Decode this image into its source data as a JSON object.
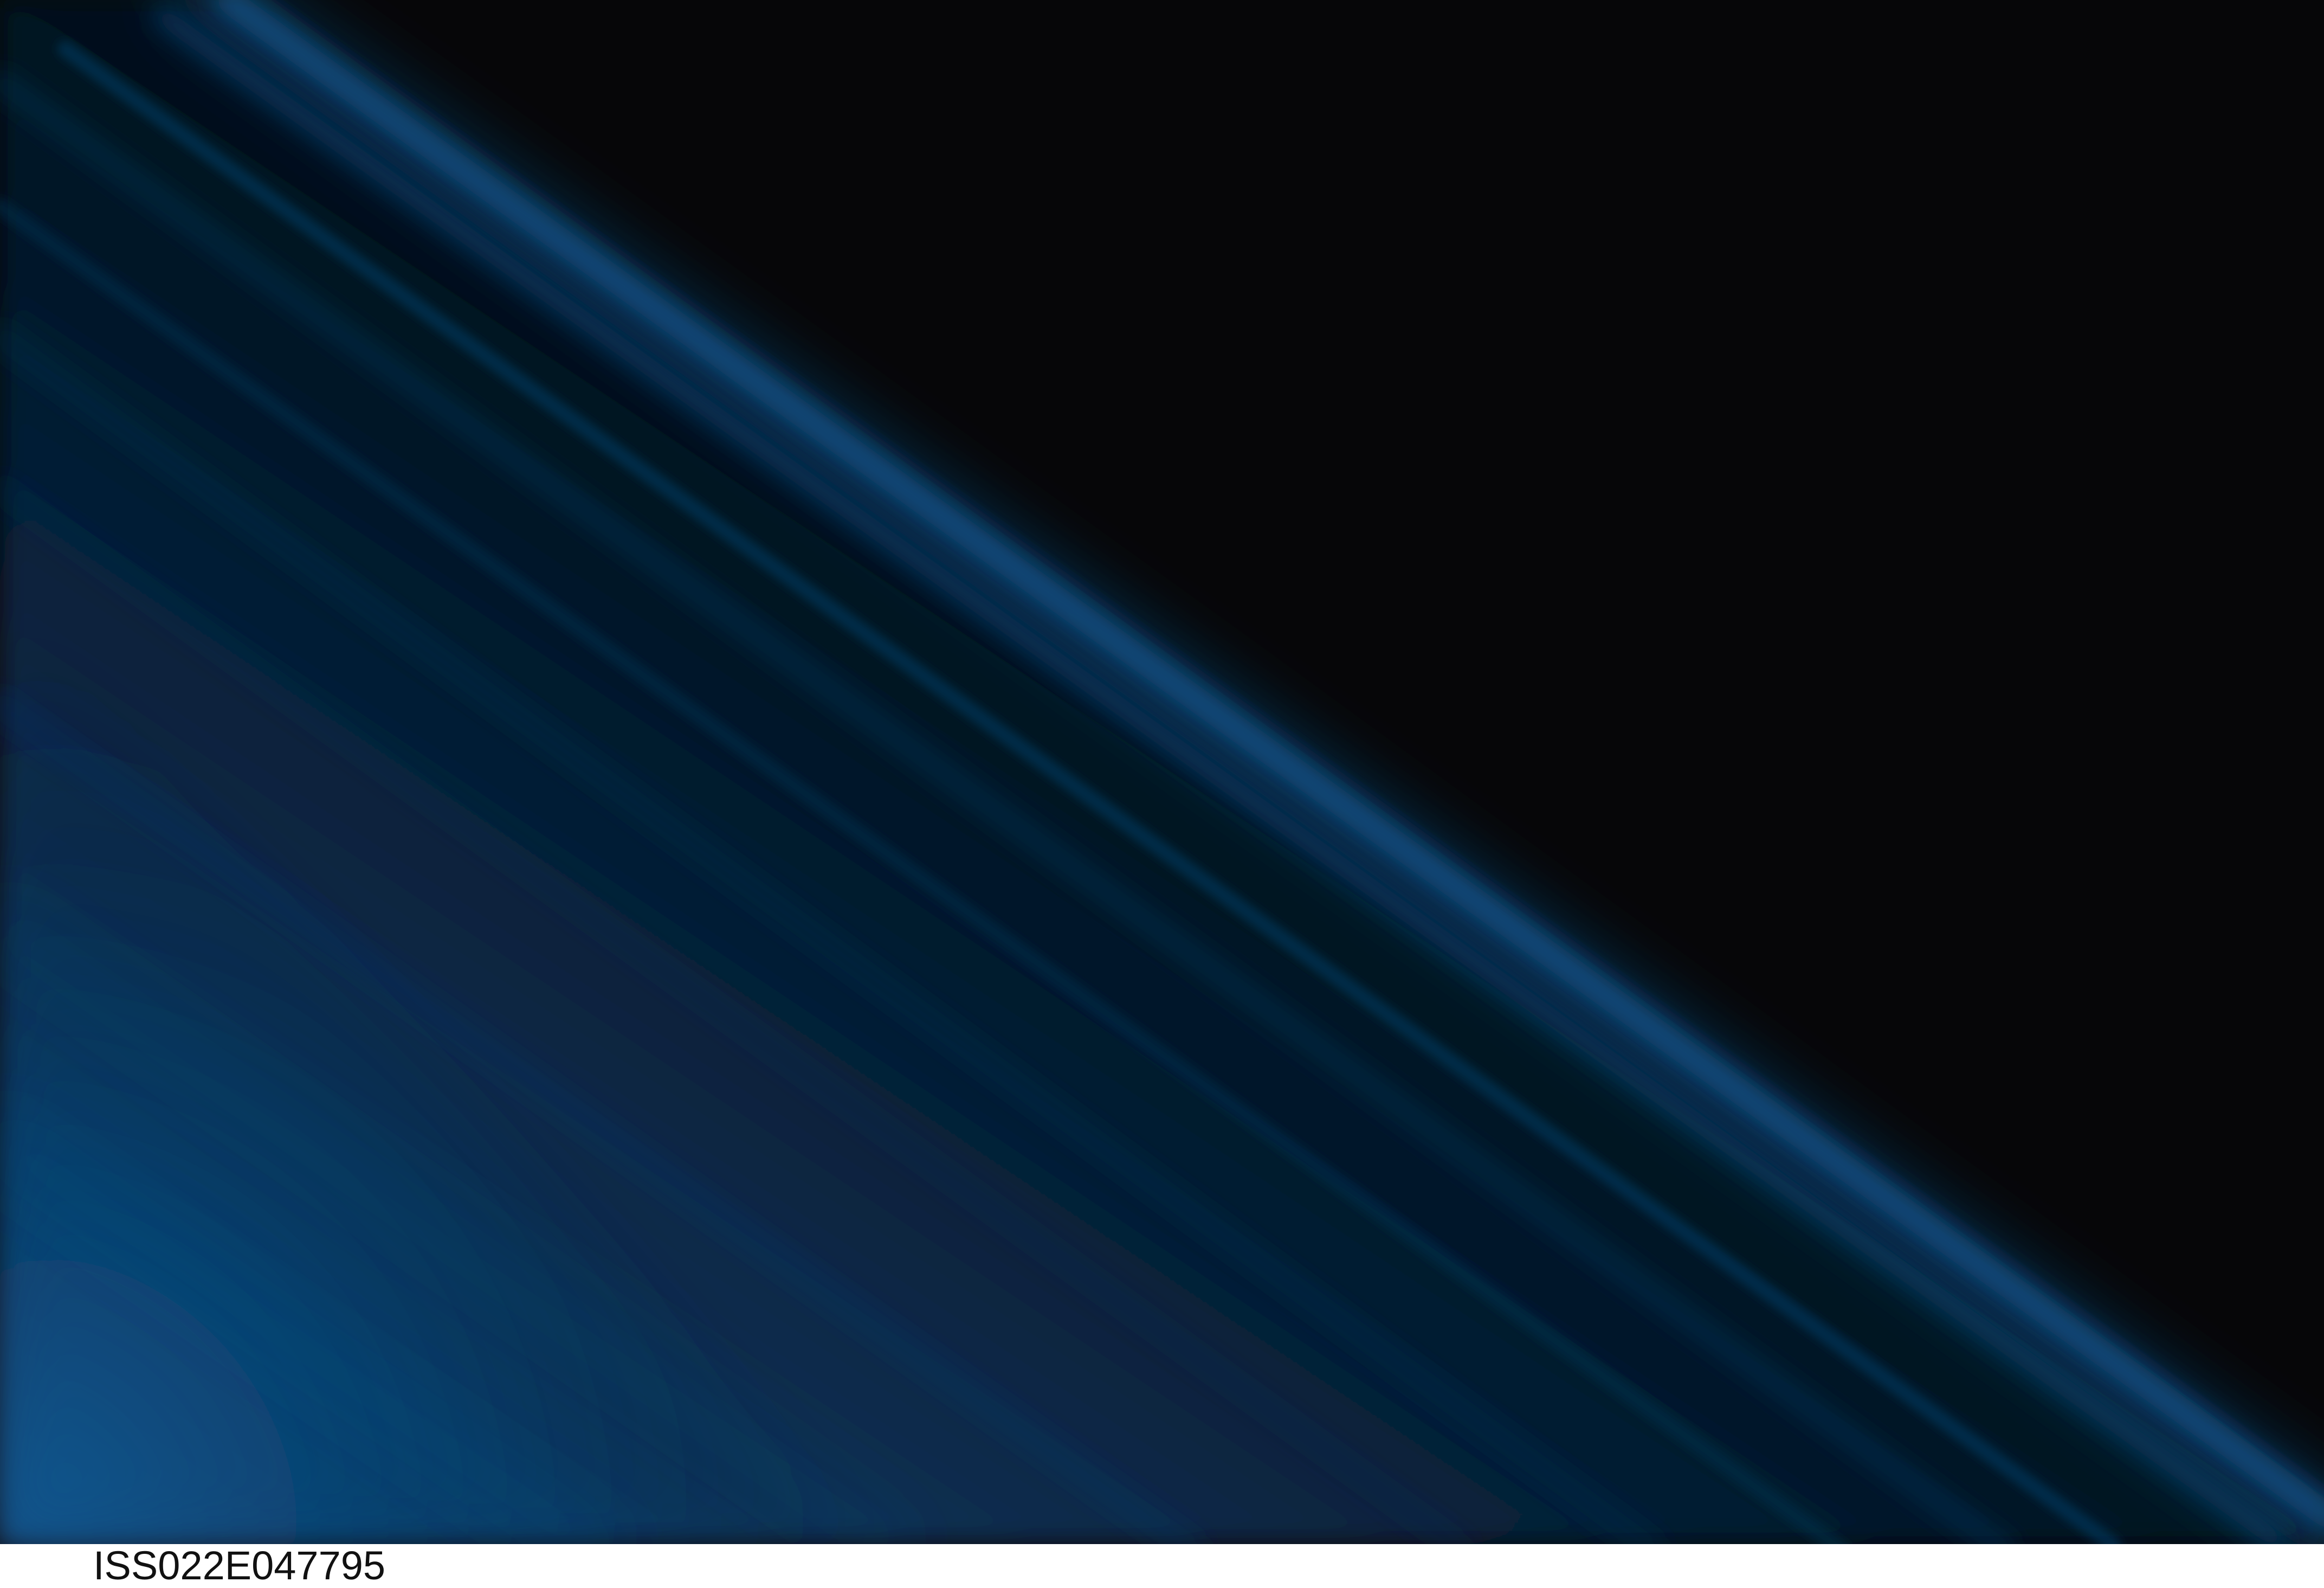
{
  "photo": {
    "subject": "airglow-streaks",
    "colors": {
      "space": "#060608",
      "glow_bright": "#0f5a92",
      "glow_mid": "#0a3358",
      "glow_deep": "#071a30"
    }
  },
  "caption": {
    "image_id": "ISS022E047795"
  }
}
